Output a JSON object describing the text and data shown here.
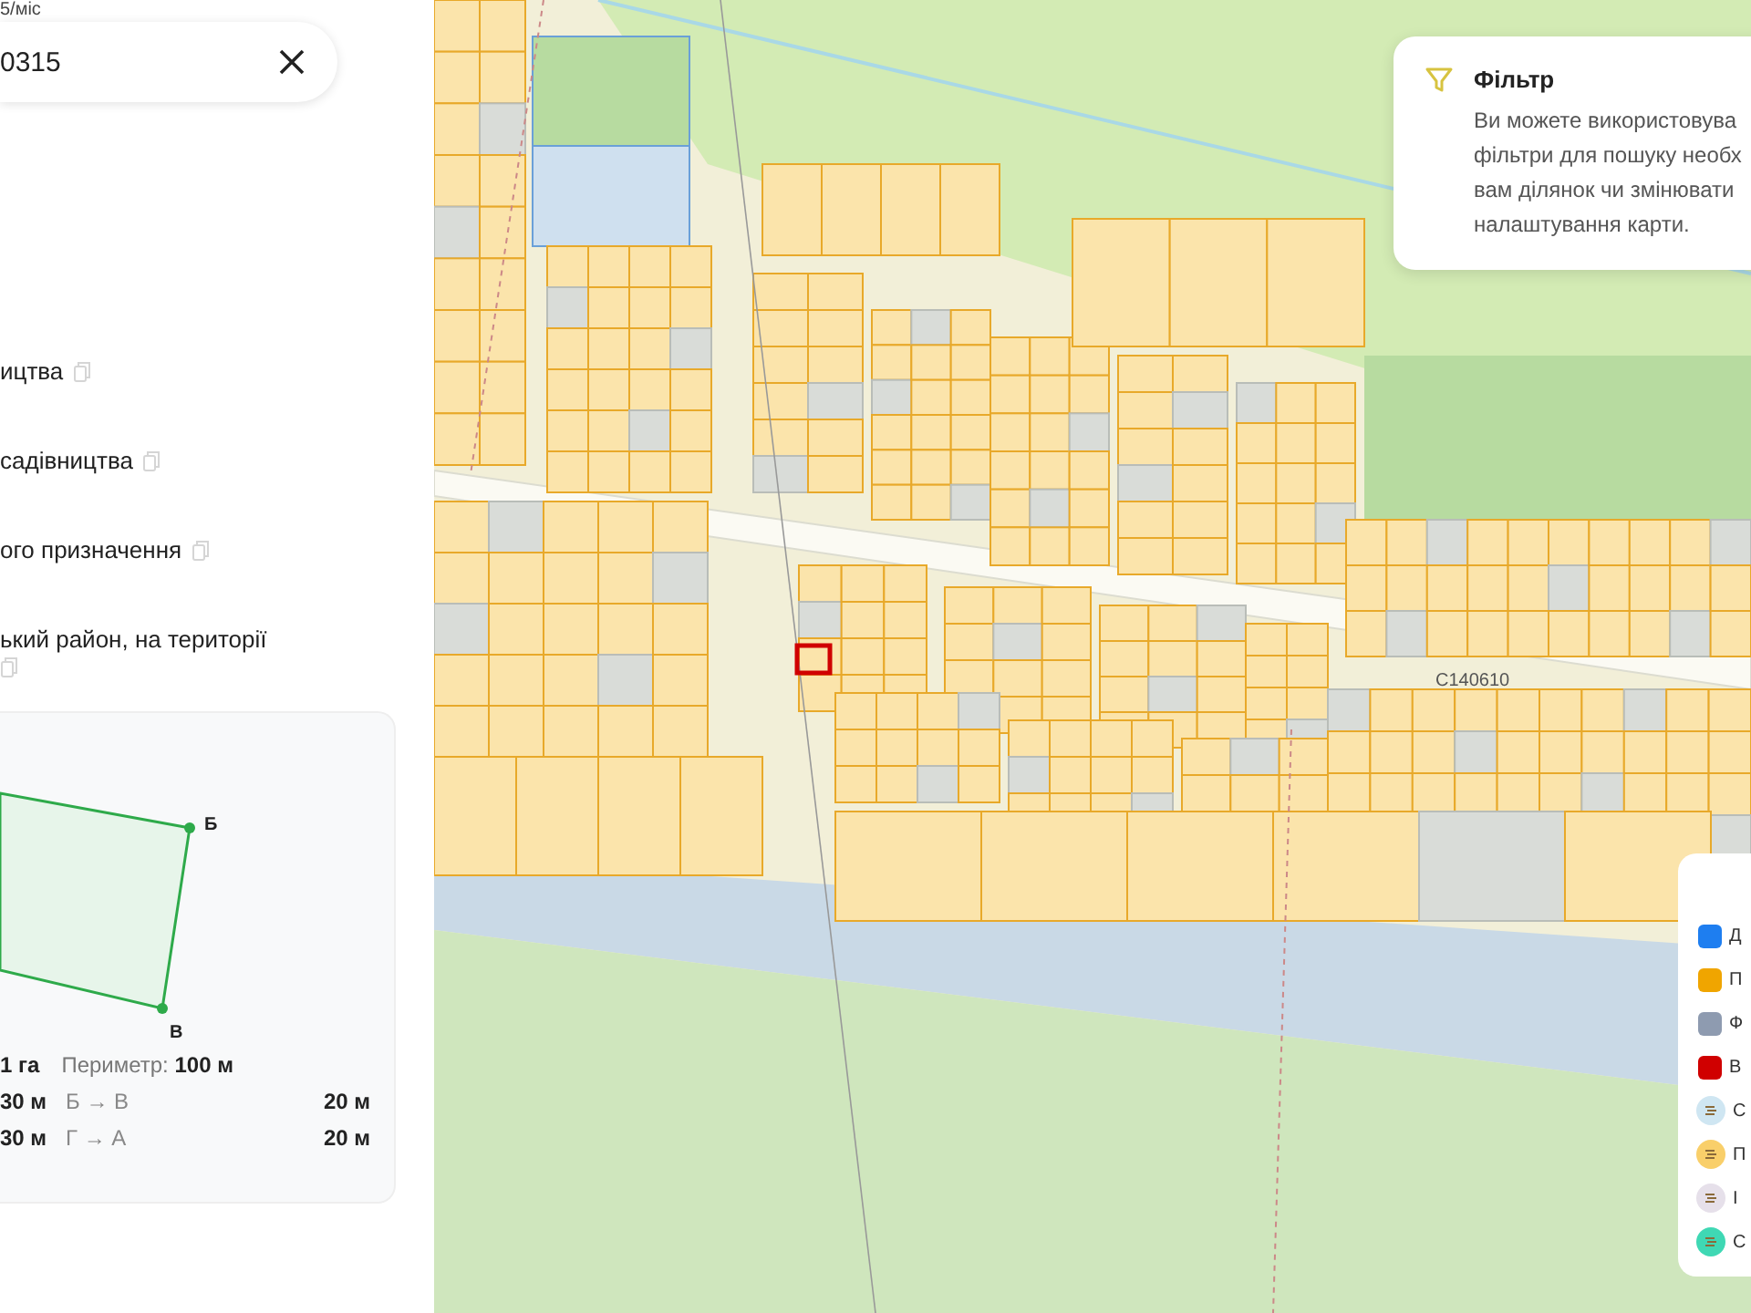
{
  "top_text": "5/міс",
  "search": {
    "value": "0315"
  },
  "details": [
    {
      "text": "ицтва"
    },
    {
      "text": "садівництва"
    },
    {
      "text": "ого призначення"
    },
    {
      "text": "ький район, на території"
    }
  ],
  "plot": {
    "vertices": [
      {
        "label": "Б"
      },
      {
        "label": "В"
      }
    ],
    "area": "1 га",
    "perimeter": "Периметр: **100 м**",
    "sides": [
      {
        "length": "30 м",
        "name": "Б → В",
        "length2": "20 м"
      },
      {
        "length": "30 м",
        "name": "Г → А",
        "length2": "20 м"
      }
    ]
  },
  "map": {
    "road_label": "С140610"
  },
  "filter_tip": {
    "title": "Фільтр",
    "lines": [
      "Ви можете використовува",
      "фільтри для пошуку необх",
      "вам ділянок чи змінювати",
      "налаштування карти."
    ]
  },
  "legend": [
    {
      "kind": "swatch",
      "color": "#1e7ef0",
      "label": "Д"
    },
    {
      "kind": "swatch",
      "color": "#f0a500",
      "label": "П"
    },
    {
      "kind": "swatch",
      "color": "#8e9bb0",
      "label": "Ф"
    },
    {
      "kind": "swatch",
      "color": "#d00000",
      "label": "В"
    },
    {
      "kind": "badge",
      "color": "#cfe6f2",
      "label": "С"
    },
    {
      "kind": "badge",
      "color": "#f9cf6a",
      "label": "П"
    },
    {
      "kind": "badge",
      "color": "#e6e0ea",
      "label": "І"
    },
    {
      "kind": "badge",
      "color": "#3fd8b4",
      "label": "С"
    }
  ]
}
